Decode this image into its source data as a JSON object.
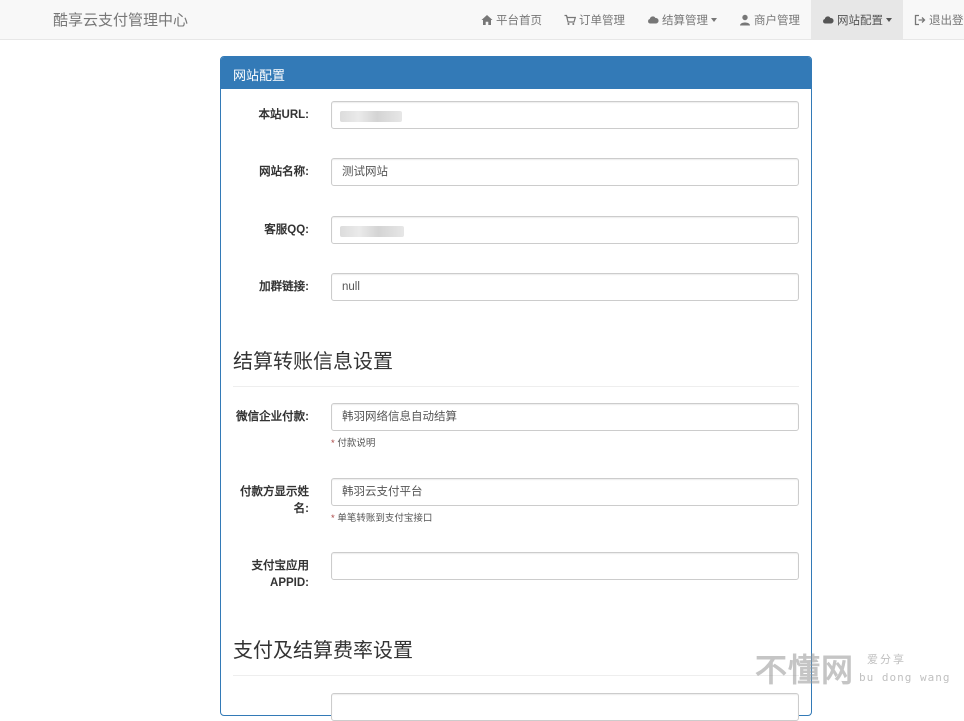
{
  "brand": "酷享云支付管理中心",
  "nav": {
    "items": [
      {
        "label": "平台首页",
        "icon": "home-icon"
      },
      {
        "label": "订单管理",
        "icon": "cart-icon"
      },
      {
        "label": "结算管理",
        "icon": "cloud-icon",
        "dropdown": true
      },
      {
        "label": "商户管理",
        "icon": "user-icon"
      },
      {
        "label": "网站配置",
        "icon": "cloud-icon",
        "dropdown": true,
        "active": true
      },
      {
        "label": "退出登录",
        "icon": "logout-icon"
      }
    ]
  },
  "panel": {
    "heading": "网站配置",
    "fields": {
      "site_url": {
        "label": "本站URL:",
        "value": ""
      },
      "site_name": {
        "label": "网站名称:",
        "value": "测试网站"
      },
      "service_qq": {
        "label": "客服QQ:",
        "value": ""
      },
      "group_link": {
        "label": "加群链接:",
        "value": "null"
      }
    },
    "section_transfer": {
      "title": "结算转账信息设置",
      "wechat_pay": {
        "label": "微信企业付款:",
        "value": "韩羽网络信息自动结算",
        "help": "付款说明"
      },
      "payer_name": {
        "label_line1": "付款方显示姓",
        "label_line2": "名:",
        "value": "韩羽云支付平台",
        "help": "单笔转账到支付宝接口"
      },
      "alipay_appid": {
        "label_line1": "支付宝应用",
        "label_line2": "APPID:",
        "value": ""
      }
    },
    "section_fee": {
      "title": "支付及结算费率设置"
    }
  },
  "watermark": {
    "main": "不懂网",
    "sub1": "爱分享",
    "sub2": "bu dong wang"
  },
  "colors": {
    "primary": "#337ab7",
    "navbar_bg": "#f8f8f8",
    "help_star": "#a94442"
  }
}
